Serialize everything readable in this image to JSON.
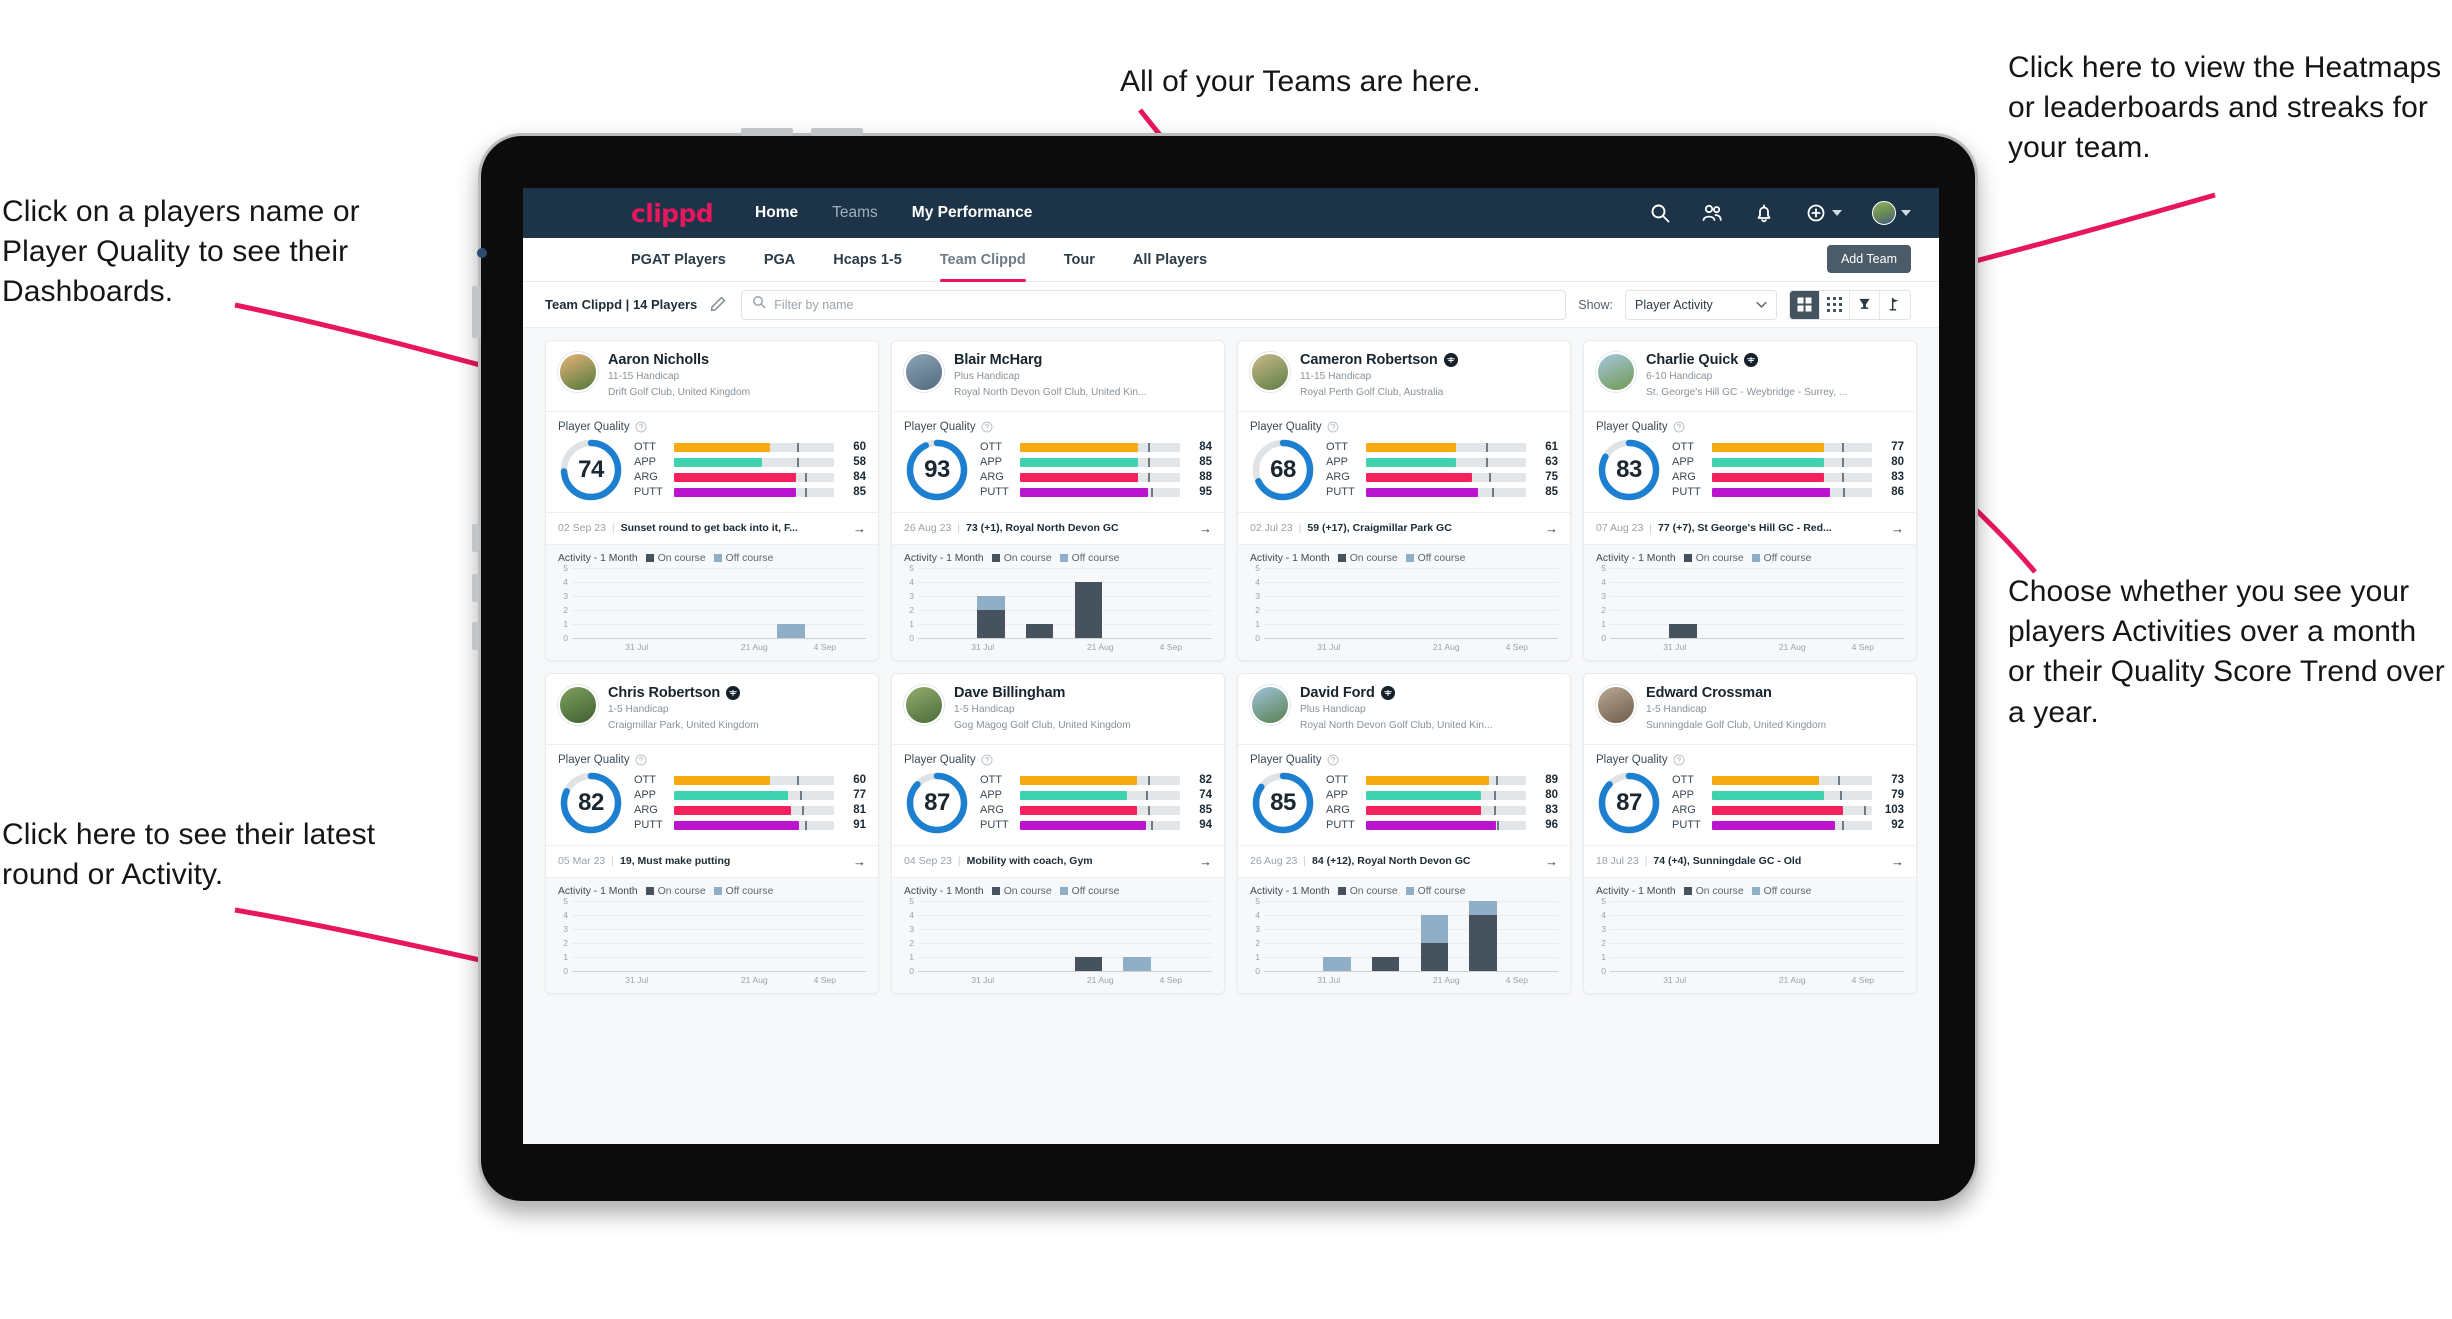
{
  "annotations": {
    "top_left": "Click on a players name or Player Quality to see their Dashboards.",
    "bottom_left": "Click here to see their latest round or Activity.",
    "top_center": "All of your Teams are here.",
    "top_right": "Click here to view the Heatmaps or leaderboards and streaks for your team.",
    "bottom_right": "Choose whether you see your players Activities over a month or their Quality Score Trend over a year.",
    "arrow_color": "#e8175d"
  },
  "navbar": {
    "brand": "clippd",
    "links": [
      {
        "label": "Home",
        "active": true
      },
      {
        "label": "Teams",
        "active": false
      },
      {
        "label": "My Performance",
        "active": true
      }
    ],
    "icons": [
      "search-icon",
      "people-icon",
      "bell-icon",
      "plus-circle-icon",
      "avatar"
    ]
  },
  "tabs": [
    {
      "label": "PGAT Players",
      "active": false
    },
    {
      "label": "PGA",
      "active": false
    },
    {
      "label": "Hcaps 1-5",
      "active": false
    },
    {
      "label": "Team Clippd",
      "active": true
    },
    {
      "label": "Tour",
      "active": false
    },
    {
      "label": "All Players",
      "active": false
    }
  ],
  "add_team_label": "Add Team",
  "filterbar": {
    "team_name": "Team Clippd",
    "team_count": "14 Players",
    "separator": "|",
    "edit_icon": "pencil-icon",
    "search_placeholder": "Filter by name",
    "search_value": "",
    "show_label": "Show:",
    "show_value": "Player Activity",
    "view_buttons": [
      {
        "name": "card-view-icon",
        "active": true
      },
      {
        "name": "compact-grid-icon",
        "active": false
      },
      {
        "name": "trophy-icon",
        "active": false
      },
      {
        "name": "golf-flag-icon",
        "active": false
      }
    ]
  },
  "card_labels": {
    "player_quality": "Player Quality",
    "activity_title": "Activity - 1 Month",
    "legend_on": "On course",
    "legend_off": "Off course",
    "metric_names": [
      "OTT",
      "APP",
      "ARG",
      "PUTT"
    ],
    "x_ticks": [
      "31 Jul",
      "21 Aug",
      "4 Sep"
    ],
    "y_ticks": [
      "5",
      "4",
      "3",
      "2",
      "1",
      "0"
    ],
    "arrow": "→"
  },
  "colors": {
    "brand_pink": "#e8175d",
    "navbar": "#1d3347",
    "ring": "#1d7fd0",
    "ott": "#f5aa12",
    "app": "#3fd2ae",
    "arg": "#f5215c",
    "putt": "#bb14cf",
    "on_course": "#46535e",
    "off_course": "#90aec5"
  },
  "players": [
    {
      "name": "Aaron Nicholls",
      "verified": false,
      "handicap": "11-15 Handicap",
      "club": "Drift Golf Club, United Kingdom",
      "quality": 74,
      "avatar": [
        "#e8b27a",
        "#4f7a3a"
      ],
      "metrics": [
        {
          "label": "OTT",
          "value": 60,
          "fill": 60,
          "tick": 77
        },
        {
          "label": "APP",
          "value": 58,
          "fill": 55,
          "tick": 77
        },
        {
          "label": "ARG",
          "value": 84,
          "fill": 76,
          "tick": 82
        },
        {
          "label": "PUTT",
          "value": 85,
          "fill": 76,
          "tick": 82
        }
      ],
      "round_date": "02 Sep 23",
      "round_text": "Sunset round to get back into it, F...",
      "activity": [
        {
          "on": 0,
          "off": 0
        },
        {
          "on": 0,
          "off": 0
        },
        {
          "on": 0,
          "off": 0
        },
        {
          "on": 0,
          "off": 0
        },
        {
          "on": 0,
          "off": 1
        },
        {
          "on": 0,
          "off": 0
        }
      ]
    },
    {
      "name": "Blair McHarg",
      "verified": false,
      "handicap": "Plus Handicap",
      "club": "Royal North Devon Golf Club, United Kin...",
      "quality": 93,
      "avatar": [
        "#8fa5b8",
        "#51697e"
      ],
      "metrics": [
        {
          "label": "OTT",
          "value": 84,
          "fill": 74,
          "tick": 80
        },
        {
          "label": "APP",
          "value": 85,
          "fill": 74,
          "tick": 80
        },
        {
          "label": "ARG",
          "value": 88,
          "fill": 74,
          "tick": 80
        },
        {
          "label": "PUTT",
          "value": 95,
          "fill": 80,
          "tick": 82
        }
      ],
      "round_date": "26 Aug 23",
      "round_text": "73 (+1), Royal North Devon GC",
      "activity": [
        {
          "on": 0,
          "off": 0
        },
        {
          "on": 2,
          "off": 1
        },
        {
          "on": 1,
          "off": 0
        },
        {
          "on": 4,
          "off": 0
        },
        {
          "on": 0,
          "off": 0
        },
        {
          "on": 0,
          "off": 0
        }
      ]
    },
    {
      "name": "Cameron Robertson",
      "verified": true,
      "handicap": "11-15 Handicap",
      "club": "Royal Perth Golf Club, Australia",
      "quality": 68,
      "avatar": [
        "#c8b98a",
        "#5d7f44"
      ],
      "metrics": [
        {
          "label": "OTT",
          "value": 61,
          "fill": 56,
          "tick": 75
        },
        {
          "label": "APP",
          "value": 63,
          "fill": 56,
          "tick": 75
        },
        {
          "label": "ARG",
          "value": 75,
          "fill": 66,
          "tick": 77
        },
        {
          "label": "PUTT",
          "value": 85,
          "fill": 70,
          "tick": 79
        }
      ],
      "round_date": "02 Jul 23",
      "round_text": "59 (+17), Craigmillar Park GC",
      "activity": [
        {
          "on": 0,
          "off": 0
        },
        {
          "on": 0,
          "off": 0
        },
        {
          "on": 0,
          "off": 0
        },
        {
          "on": 0,
          "off": 0
        },
        {
          "on": 0,
          "off": 0
        },
        {
          "on": 0,
          "off": 0
        }
      ]
    },
    {
      "name": "Charlie Quick",
      "verified": true,
      "handicap": "6-10 Handicap",
      "club": "St. George's Hill GC - Weybridge - Surrey, ...",
      "quality": 83,
      "avatar": [
        "#a7c6de",
        "#6f9a52"
      ],
      "metrics": [
        {
          "label": "OTT",
          "value": 77,
          "fill": 70,
          "tick": 81
        },
        {
          "label": "APP",
          "value": 80,
          "fill": 70,
          "tick": 81
        },
        {
          "label": "ARG",
          "value": 83,
          "fill": 70,
          "tick": 81
        },
        {
          "label": "PUTT",
          "value": 86,
          "fill": 74,
          "tick": 82
        }
      ],
      "round_date": "07 Aug 23",
      "round_text": "77 (+7), St George's Hill GC - Red...",
      "activity": [
        {
          "on": 0,
          "off": 0
        },
        {
          "on": 1,
          "off": 0
        },
        {
          "on": 0,
          "off": 0
        },
        {
          "on": 0,
          "off": 0
        },
        {
          "on": 0,
          "off": 0
        },
        {
          "on": 0,
          "off": 0
        }
      ]
    },
    {
      "name": "Chris Robertson",
      "verified": true,
      "handicap": "1-5 Handicap",
      "club": "Craigmillar Park, United Kingdom",
      "quality": 82,
      "avatar": [
        "#7fa05e",
        "#3f6030"
      ],
      "metrics": [
        {
          "label": "OTT",
          "value": 60,
          "fill": 60,
          "tick": 77
        },
        {
          "label": "APP",
          "value": 77,
          "fill": 71,
          "tick": 79
        },
        {
          "label": "ARG",
          "value": 81,
          "fill": 73,
          "tick": 80
        },
        {
          "label": "PUTT",
          "value": 91,
          "fill": 78,
          "tick": 82
        }
      ],
      "round_date": "05 Mar 23",
      "round_text": "19, Must make putting",
      "activity": [
        {
          "on": 0,
          "off": 0
        },
        {
          "on": 0,
          "off": 0
        },
        {
          "on": 0,
          "off": 0
        },
        {
          "on": 0,
          "off": 0
        },
        {
          "on": 0,
          "off": 0
        },
        {
          "on": 0,
          "off": 0
        }
      ]
    },
    {
      "name": "Dave Billingham",
      "verified": false,
      "handicap": "1-5 Handicap",
      "club": "Gog Magog Golf Club, United Kingdom",
      "quality": 87,
      "avatar": [
        "#94ad6e",
        "#4a6b3a"
      ],
      "metrics": [
        {
          "label": "OTT",
          "value": 82,
          "fill": 73,
          "tick": 80
        },
        {
          "label": "APP",
          "value": 74,
          "fill": 67,
          "tick": 79
        },
        {
          "label": "ARG",
          "value": 85,
          "fill": 73,
          "tick": 80
        },
        {
          "label": "PUTT",
          "value": 94,
          "fill": 79,
          "tick": 82
        }
      ],
      "round_date": "04 Sep 23",
      "round_text": "Mobility with coach, Gym",
      "activity": [
        {
          "on": 0,
          "off": 0
        },
        {
          "on": 0,
          "off": 0
        },
        {
          "on": 0,
          "off": 0
        },
        {
          "on": 1,
          "off": 0
        },
        {
          "on": 0,
          "off": 1
        },
        {
          "on": 0,
          "off": 0
        }
      ]
    },
    {
      "name": "David Ford",
      "verified": true,
      "handicap": "Plus Handicap",
      "club": "Royal North Devon Golf Club, United Kin...",
      "quality": 85,
      "avatar": [
        "#9fc3da",
        "#5a8050"
      ],
      "metrics": [
        {
          "label": "OTT",
          "value": 89,
          "fill": 77,
          "tick": 81
        },
        {
          "label": "APP",
          "value": 80,
          "fill": 72,
          "tick": 80
        },
        {
          "label": "ARG",
          "value": 83,
          "fill": 72,
          "tick": 80
        },
        {
          "label": "PUTT",
          "value": 96,
          "fill": 81,
          "tick": 82
        }
      ],
      "round_date": "26 Aug 23",
      "round_text": "84 (+12), Royal North Devon GC",
      "activity": [
        {
          "on": 0,
          "off": 0
        },
        {
          "on": 0,
          "off": 1
        },
        {
          "on": 1,
          "off": 0
        },
        {
          "on": 2,
          "off": 2
        },
        {
          "on": 4,
          "off": 1
        },
        {
          "on": 0,
          "off": 0
        }
      ]
    },
    {
      "name": "Edward Crossman",
      "verified": false,
      "handicap": "1-5 Handicap",
      "club": "Sunningdale Golf Club, United Kingdom",
      "quality": 87,
      "avatar": [
        "#b9a894",
        "#6d5c4a"
      ],
      "metrics": [
        {
          "label": "OTT",
          "value": 73,
          "fill": 67,
          "tick": 79
        },
        {
          "label": "APP",
          "value": 79,
          "fill": 70,
          "tick": 80
        },
        {
          "label": "ARG",
          "value": 103,
          "fill": 82,
          "tick": 95
        },
        {
          "label": "PUTT",
          "value": 92,
          "fill": 77,
          "tick": 81
        }
      ],
      "round_date": "18 Jul 23",
      "round_text": "74 (+4), Sunningdale GC - Old",
      "activity": [
        {
          "on": 0,
          "off": 0
        },
        {
          "on": 0,
          "off": 0
        },
        {
          "on": 0,
          "off": 0
        },
        {
          "on": 0,
          "off": 0
        },
        {
          "on": 0,
          "off": 0
        },
        {
          "on": 0,
          "off": 0
        }
      ]
    }
  ]
}
